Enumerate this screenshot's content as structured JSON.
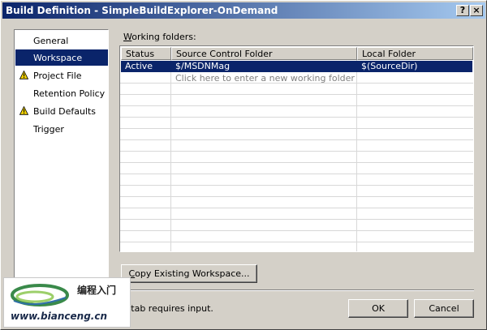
{
  "window": {
    "title": "Build Definition - SimpleBuildExplorer-OnDemand",
    "help_label": "?",
    "close_label": "×"
  },
  "sidebar": {
    "items": [
      {
        "label": "General",
        "warning": false,
        "selected": false
      },
      {
        "label": "Workspace",
        "warning": false,
        "selected": true
      },
      {
        "label": "Project File",
        "warning": true,
        "selected": false
      },
      {
        "label": "Retention Policy",
        "warning": false,
        "selected": false
      },
      {
        "label": "Build Defaults",
        "warning": true,
        "selected": false
      },
      {
        "label": "Trigger",
        "warning": false,
        "selected": false
      }
    ]
  },
  "workspace": {
    "label_accel": "W",
    "label_rest": "orking folders:",
    "columns": [
      "Status",
      "Source Control Folder",
      "Local Folder"
    ],
    "rows": [
      {
        "status": "Active",
        "source": "$/MSDNMag",
        "local": "$(SourceDir)"
      }
    ],
    "new_row_hint": "Click here to enter a new working folder",
    "copy_button_accel": "C",
    "copy_button_rest": "opy Existing Workspace..."
  },
  "footer": {
    "status_message": "e tab requires input.",
    "ok_label": "OK",
    "cancel_label": "Cancel"
  },
  "watermark": {
    "chinese_text": "编程入门",
    "url": "www.bianceng.cn"
  },
  "colors": {
    "selection": "#0a246a",
    "warning": "#f0d000",
    "face": "#d4d0c8"
  }
}
